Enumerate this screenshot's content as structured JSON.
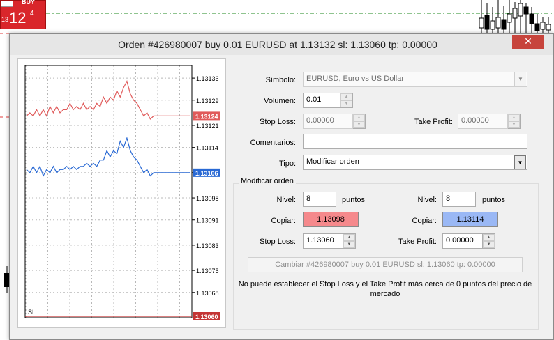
{
  "buy_panel": {
    "label": "BUY",
    "price_small": "13",
    "price_big": "12",
    "price_sup": "4"
  },
  "dialog": {
    "title": "Orden #426980007 buy 0.01 EURUSD at 1.13132 sl: 1.13060 tp: 0.00000",
    "close_glyph": "✕"
  },
  "form": {
    "symbol_label": "Símbolo:",
    "symbol_value": "EURUSD, Euro vs US Dollar",
    "volume_label": "Volumen:",
    "volume_value": "0.01",
    "stoploss_label": "Stop Loss:",
    "stoploss_value": "0.00000",
    "takeprofit_label": "Take Profit:",
    "takeprofit_value": "0.00000",
    "comment_label": "Comentarios:",
    "comment_value": "",
    "type_label": "Tipo:",
    "type_value": "Modificar orden"
  },
  "modify": {
    "group_title": "Modificar orden",
    "left": {
      "level_label": "Nivel:",
      "level_value": "8",
      "points_label": "puntos",
      "copy_label": "Copiar:",
      "copy_value": "1.13098",
      "sl_label": "Stop Loss:",
      "sl_value": "1.13060"
    },
    "right": {
      "level_label": "Nivel:",
      "level_value": "8",
      "points_label": "puntos",
      "copy_label": "Copiar:",
      "copy_value": "1.13114",
      "tp_label": "Take Profit:",
      "tp_value": "0.00000"
    },
    "button_label": "Cambiar #426980007 buy 0.01 EURUSD sl: 1.13060 tp: 0.00000",
    "note": "No puede establecer el Stop Loss y el Take Profit más cerca de 0 puntos del precio de mercado"
  },
  "colors": {
    "bid": "#2969d4",
    "ask": "#e05a5a",
    "sl": "#c43535",
    "buy_bg": "#d9262b",
    "copy_left_bg": "#f5898c",
    "copy_right_bg": "#9ab8f5"
  },
  "chart_data": {
    "type": "line",
    "y_ticks": [
      "1.13136",
      "1.13129",
      "1.13121",
      "1.13114",
      "1.13106",
      "1.13098",
      "1.13091",
      "1.13083",
      "1.13075",
      "1.13068"
    ],
    "ylim": [
      1.1306,
      1.1314
    ],
    "series": [
      {
        "role": "ask",
        "current_label": "1.13124",
        "values": [
          1.13124,
          1.13125,
          1.13124,
          1.13126,
          1.13124,
          1.13126,
          1.13124,
          1.13127,
          1.13125,
          1.13127,
          1.13125,
          1.13126,
          1.13126,
          1.13128,
          1.13126,
          1.13127,
          1.13126,
          1.13128,
          1.13126,
          1.13127,
          1.13126,
          1.13128,
          1.13127,
          1.1313,
          1.13128,
          1.1313,
          1.13129,
          1.13132,
          1.1313,
          1.13133,
          1.13135,
          1.13131,
          1.13129,
          1.13128,
          1.13126,
          1.13124,
          1.13125,
          1.13123,
          1.13124,
          1.13124,
          1.13124,
          1.13124,
          1.13124,
          1.13124,
          1.13124,
          1.13124,
          1.13124,
          1.13124,
          1.13124,
          1.13124
        ]
      },
      {
        "role": "bid",
        "current_label": "1.13106",
        "values": [
          1.13107,
          1.13106,
          1.13108,
          1.13106,
          1.13108,
          1.13105,
          1.13107,
          1.13106,
          1.13108,
          1.13106,
          1.13107,
          1.13107,
          1.13108,
          1.13107,
          1.13108,
          1.13107,
          1.13108,
          1.13108,
          1.13109,
          1.13108,
          1.13109,
          1.13108,
          1.1311,
          1.1311,
          1.13113,
          1.13111,
          1.13113,
          1.13112,
          1.13116,
          1.13114,
          1.13117,
          1.13113,
          1.13111,
          1.1311,
          1.13108,
          1.13106,
          1.13107,
          1.13105,
          1.13106,
          1.13106,
          1.13106,
          1.13106,
          1.13106,
          1.13106,
          1.13106,
          1.13106,
          1.13106,
          1.13106,
          1.13106,
          1.13106
        ]
      }
    ],
    "stop_loss": {
      "value": 1.1306,
      "label": "SL",
      "price_label": "1.13060"
    }
  }
}
